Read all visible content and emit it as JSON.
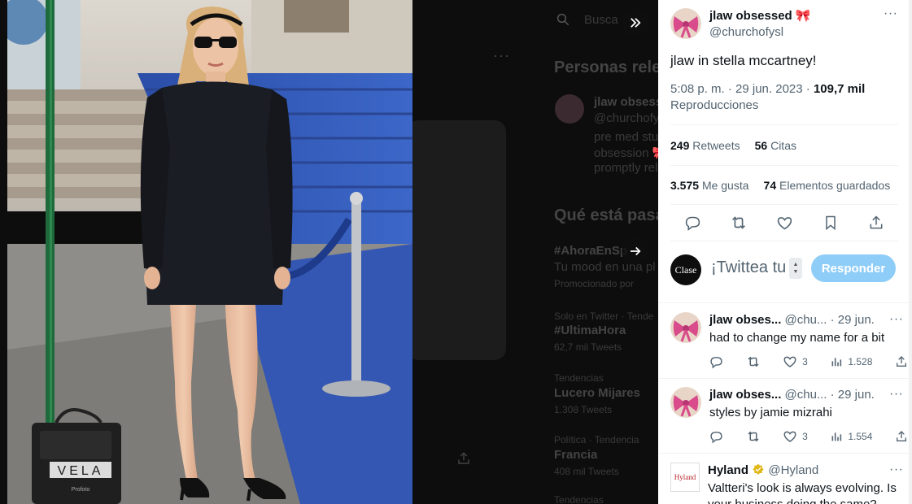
{
  "background": {
    "search_placeholder": "Busca",
    "people_heading": "Personas rele",
    "people_name": "jlaw obsess",
    "people_handle": "@churchofysl",
    "people_bio_1": "pre med stu",
    "people_bio_2": "obsession 🎀",
    "people_bio_3": "promptly rel",
    "trending_heading": "Qué está pasa",
    "trend1_tag": "#AhoraEnSp",
    "trend1_sub": "Tu mood en una pl",
    "trend1_promo": "Promocionado por",
    "trend2_context": "Solo en Twitter · Tende",
    "trend2_tag": "#UltimaHora",
    "trend2_count": "62,7 mil Tweets",
    "trend3_context": "Tendencias",
    "trend3_name": "Lucero Mijares",
    "trend3_count": "1.308 Tweets",
    "trend4_context": "Política · Tendencia",
    "trend4_name": "Francia",
    "trend4_count": "408 mil Tweets",
    "trend5_context": "Tendencias",
    "photo_brand": "VELA",
    "photo_brand_small": "Profoto"
  },
  "main_tweet": {
    "name": "jlaw obsessed 🎀",
    "handle": "@churchofysl",
    "text": "jlaw in stella mccartney!",
    "time": "5:08 p. m. · 29 jun. 2023 · ",
    "views": "109,7 mil",
    "views_label": "Reproducciones",
    "retweets": "249",
    "retweets_label": "Retweets",
    "quotes": "56",
    "quotes_label": "Citas",
    "likes": "3.575",
    "likes_label": "Me gusta",
    "bookmarks": "74",
    "bookmarks_label": "Elementos guardados"
  },
  "compose": {
    "avatar_text": "Clase",
    "placeholder": "¡Twittea tu",
    "reply_button": "Responder"
  },
  "replies": [
    {
      "name": "jlaw obses...",
      "handle": "@chu...",
      "date": "· 29 jun.",
      "text": "had to change my name for a bit",
      "likes": "3",
      "views": "1.528"
    },
    {
      "name": "jlaw obses...",
      "handle": "@chu...",
      "date": "· 29 jun.",
      "text": "styles by jamie mizrahi",
      "likes": "3",
      "views": "1.554"
    },
    {
      "name": "Hyland",
      "handle": "@Hyland",
      "logo_text": "Hyland",
      "text": "Valtteri's look is always evolving. Is your business doing the same?"
    }
  ],
  "colors": {
    "reply_button": "#8ecdf8",
    "text_primary": "#0f1419",
    "text_secondary": "#536471",
    "bow_pink": "#d94b8a",
    "verified_gold": "#e2b719"
  },
  "icons": {
    "search": "search-icon",
    "collapse": "chevron-double-right-icon",
    "next": "arrow-right-icon",
    "reply": "reply-icon",
    "retweet": "retweet-icon",
    "like": "heart-icon",
    "bookmark": "bookmark-icon",
    "share": "share-icon",
    "views": "views-icon",
    "more": "more-icon"
  }
}
